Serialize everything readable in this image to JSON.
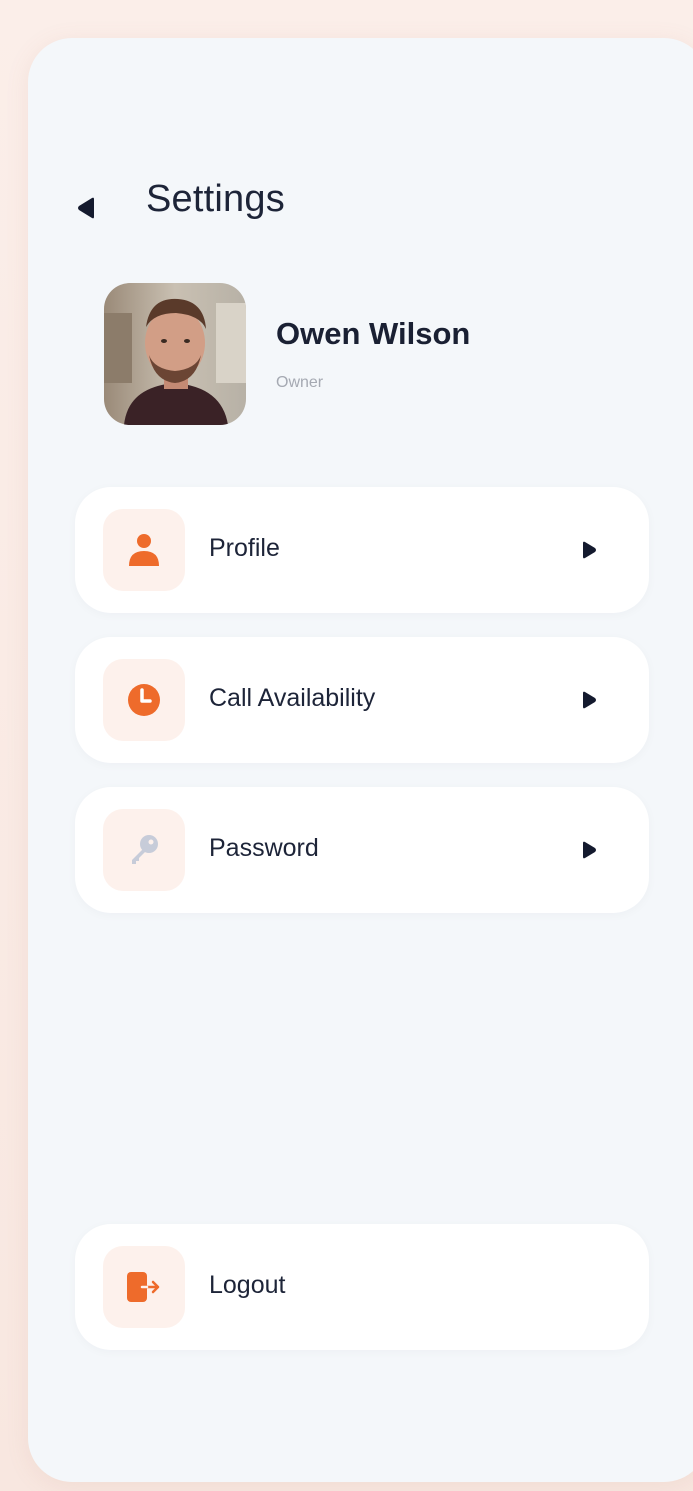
{
  "header": {
    "title": "Settings",
    "back_icon": "back-arrow-icon"
  },
  "user": {
    "name": "Owen Wilson",
    "role": "Owner"
  },
  "menu": [
    {
      "label": "Profile",
      "icon": "person-icon"
    },
    {
      "label": "Call Availability",
      "icon": "clock-icon"
    },
    {
      "label": "Password",
      "icon": "key-icon"
    }
  ],
  "logout": {
    "label": "Logout",
    "icon": "logout-icon"
  },
  "colors": {
    "accent": "#ee6b2b",
    "text": "#1d2438",
    "muted": "#a5a9b2",
    "icon_bg": "#fdf1ec",
    "screen_bg": "#f4f7fa"
  }
}
